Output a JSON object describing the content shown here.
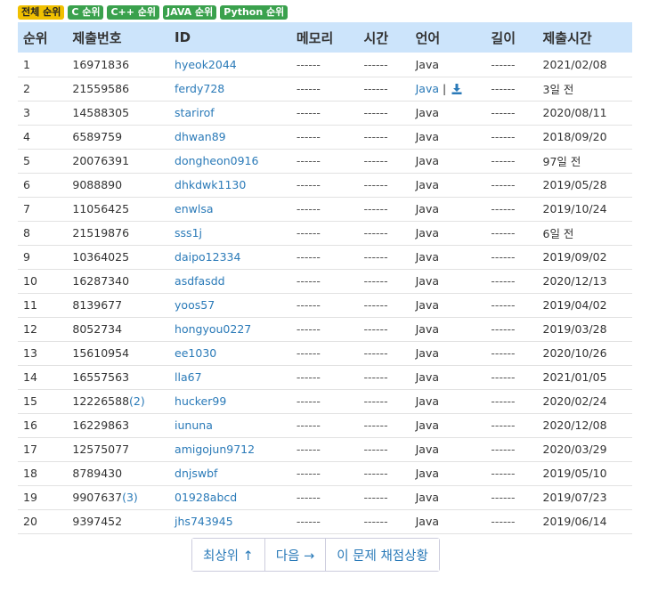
{
  "badges": [
    {
      "label": "전체 순위",
      "kind": "all"
    },
    {
      "label": "C 순위",
      "kind": "lang"
    },
    {
      "label": "C++ 순위",
      "kind": "lang"
    },
    {
      "label": "JAVA 순위",
      "kind": "lang"
    },
    {
      "label": "Python 순위",
      "kind": "lang"
    }
  ],
  "table": {
    "headers": [
      "순위",
      "제출번호",
      "ID",
      "메모리",
      "시간",
      "언어",
      "길이",
      "제출시간"
    ],
    "rows": [
      {
        "rank": "1",
        "submit": "16971836",
        "extra": "",
        "id": "hyeok2044",
        "memory": "------",
        "time": "------",
        "lang": "Java",
        "download": false,
        "length": "------",
        "date": "2021/02/08"
      },
      {
        "rank": "2",
        "submit": "21559586",
        "extra": "",
        "id": "ferdy728",
        "memory": "------",
        "time": "------",
        "lang": "Java",
        "download": true,
        "length": "------",
        "date": "3일 전"
      },
      {
        "rank": "3",
        "submit": "14588305",
        "extra": "",
        "id": "starirof",
        "memory": "------",
        "time": "------",
        "lang": "Java",
        "download": false,
        "length": "------",
        "date": "2020/08/11"
      },
      {
        "rank": "4",
        "submit": "6589759",
        "extra": "",
        "id": "dhwan89",
        "memory": "------",
        "time": "------",
        "lang": "Java",
        "download": false,
        "length": "------",
        "date": "2018/09/20"
      },
      {
        "rank": "5",
        "submit": "20076391",
        "extra": "",
        "id": "dongheon0916",
        "memory": "------",
        "time": "------",
        "lang": "Java",
        "download": false,
        "length": "------",
        "date": "97일 전"
      },
      {
        "rank": "6",
        "submit": "9088890",
        "extra": "",
        "id": "dhkdwk1130",
        "memory": "------",
        "time": "------",
        "lang": "Java",
        "download": false,
        "length": "------",
        "date": "2019/05/28"
      },
      {
        "rank": "7",
        "submit": "11056425",
        "extra": "",
        "id": "enwlsa",
        "memory": "------",
        "time": "------",
        "lang": "Java",
        "download": false,
        "length": "------",
        "date": "2019/10/24"
      },
      {
        "rank": "8",
        "submit": "21519876",
        "extra": "",
        "id": "sss1j",
        "memory": "------",
        "time": "------",
        "lang": "Java",
        "download": false,
        "length": "------",
        "date": "6일 전"
      },
      {
        "rank": "9",
        "submit": "10364025",
        "extra": "",
        "id": "daipo12334",
        "memory": "------",
        "time": "------",
        "lang": "Java",
        "download": false,
        "length": "------",
        "date": "2019/09/02"
      },
      {
        "rank": "10",
        "submit": "16287340",
        "extra": "",
        "id": "asdfasdd",
        "memory": "------",
        "time": "------",
        "lang": "Java",
        "download": false,
        "length": "------",
        "date": "2020/12/13"
      },
      {
        "rank": "11",
        "submit": "8139677",
        "extra": "",
        "id": "yoos57",
        "memory": "------",
        "time": "------",
        "lang": "Java",
        "download": false,
        "length": "------",
        "date": "2019/04/02"
      },
      {
        "rank": "12",
        "submit": "8052734",
        "extra": "",
        "id": "hongyou0227",
        "memory": "------",
        "time": "------",
        "lang": "Java",
        "download": false,
        "length": "------",
        "date": "2019/03/28"
      },
      {
        "rank": "13",
        "submit": "15610954",
        "extra": "",
        "id": "ee1030",
        "memory": "------",
        "time": "------",
        "lang": "Java",
        "download": false,
        "length": "------",
        "date": "2020/10/26"
      },
      {
        "rank": "14",
        "submit": "16557563",
        "extra": "",
        "id": "lla67",
        "memory": "------",
        "time": "------",
        "lang": "Java",
        "download": false,
        "length": "------",
        "date": "2021/01/05"
      },
      {
        "rank": "15",
        "submit": "12226588",
        "extra": "(2)",
        "id": "hucker99",
        "memory": "------",
        "time": "------",
        "lang": "Java",
        "download": false,
        "length": "------",
        "date": "2020/02/24"
      },
      {
        "rank": "16",
        "submit": "16229863",
        "extra": "",
        "id": "iununa",
        "memory": "------",
        "time": "------",
        "lang": "Java",
        "download": false,
        "length": "------",
        "date": "2020/12/08"
      },
      {
        "rank": "17",
        "submit": "12575077",
        "extra": "",
        "id": "amigojun9712",
        "memory": "------",
        "time": "------",
        "lang": "Java",
        "download": false,
        "length": "------",
        "date": "2020/03/29"
      },
      {
        "rank": "18",
        "submit": "8789430",
        "extra": "",
        "id": "dnjswbf",
        "memory": "------",
        "time": "------",
        "lang": "Java",
        "download": false,
        "length": "------",
        "date": "2019/05/10"
      },
      {
        "rank": "19",
        "submit": "9907637",
        "extra": "(3)",
        "id": "01928abcd",
        "memory": "------",
        "time": "------",
        "lang": "Java",
        "download": false,
        "length": "------",
        "date": "2019/07/23"
      },
      {
        "rank": "20",
        "submit": "9397452",
        "extra": "",
        "id": "jhs743945",
        "memory": "------",
        "time": "------",
        "lang": "Java",
        "download": false,
        "length": "------",
        "date": "2019/06/14"
      }
    ]
  },
  "pager": {
    "top": "최상위 ↑",
    "next": "다음 →",
    "status": "이 문제 채점상황"
  },
  "colors": {
    "header_bg": "#cce4fb",
    "link": "#2a7ab8",
    "badge_all": "#f0c000",
    "badge_lang": "#3aa14d"
  }
}
